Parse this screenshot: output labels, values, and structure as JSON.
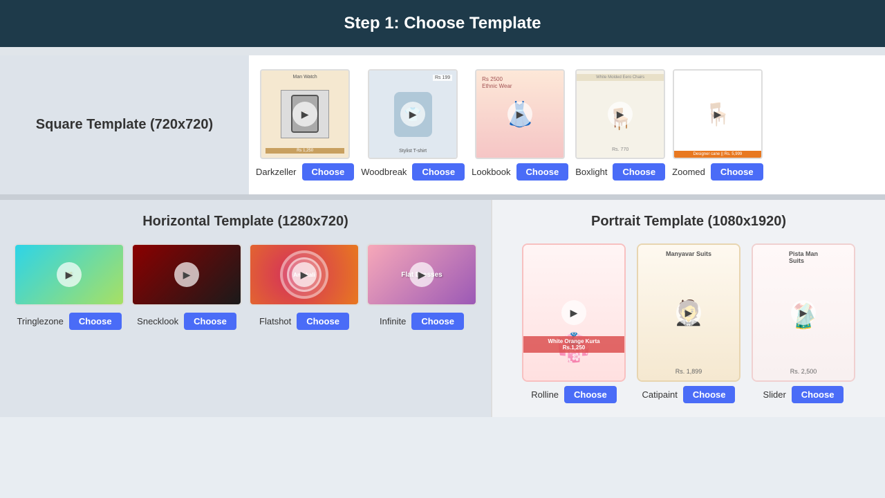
{
  "header": {
    "title": "Step 1: Choose Template"
  },
  "square_section": {
    "label": "Square Template (720x720)",
    "templates": [
      {
        "name": "Darkzeller",
        "style": "darkzeller"
      },
      {
        "name": "Woodbreak",
        "style": "woodbreak"
      },
      {
        "name": "Lookbook",
        "style": "lookbook"
      },
      {
        "name": "Boxlight",
        "style": "boxlight"
      },
      {
        "name": "Zoomed",
        "style": "zoomed"
      }
    ],
    "choose_label": "Choose"
  },
  "horizontal_section": {
    "label": "Horizontal Template (1280x720)",
    "templates": [
      {
        "name": "Tringlezone",
        "style": "tringlezone"
      },
      {
        "name": "Snecklook",
        "style": "snecklook"
      },
      {
        "name": "Flatshot",
        "style": "flatshot"
      },
      {
        "name": "Infinite",
        "style": "infinite"
      }
    ],
    "choose_label": "Choose"
  },
  "portrait_section": {
    "label": "Portrait Template (1080x1920)",
    "templates": [
      {
        "name": "Rolline",
        "style": "rolline",
        "product": "White Orange Kurta",
        "price": "Rs.1,250"
      },
      {
        "name": "Catipaint",
        "style": "catipaint",
        "product": "Manyavar Suits",
        "price": "Rs. 1,899"
      },
      {
        "name": "Slider",
        "style": "slider",
        "product": "Pista Man Suits",
        "price": "Rs. 2,500"
      }
    ],
    "choose_label": "Choose"
  }
}
